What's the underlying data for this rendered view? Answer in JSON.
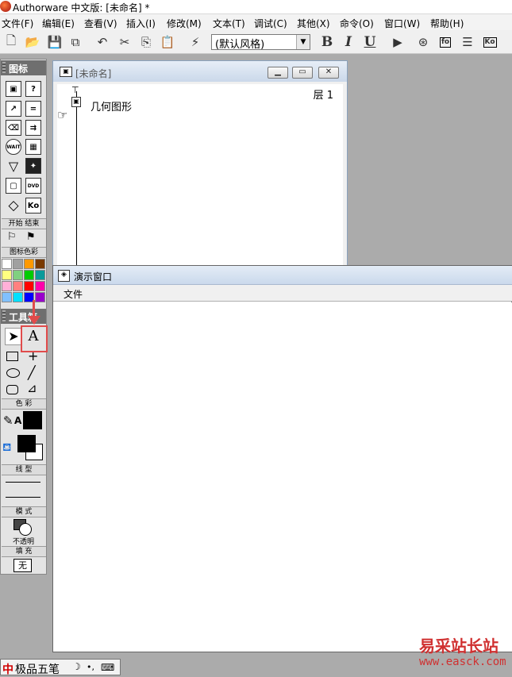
{
  "window": {
    "title": "Authorware 中文版: [未命名] *"
  },
  "menu": [
    "文件(F)",
    "编辑(E)",
    "查看(V)",
    "插入(I)",
    "修改(M)",
    "文本(T)",
    "调试(C)",
    "其他(X)",
    "命令(O)",
    "窗口(W)",
    "帮助(H)"
  ],
  "toolbar": {
    "style_value": "(默认风格)",
    "bold": "B",
    "italic": "I",
    "underline": "U",
    "btn_fo": "fo",
    "btn_ko": "Ko"
  },
  "palette": {
    "icons_header": "图标",
    "icon_wait_label": "WAIT",
    "icon_dvd_label": "DVD",
    "icon_ko_label": "Ko",
    "start_end_label": "开始 结束",
    "icon_color_label": "图标色彩",
    "icon_colors": [
      "#ffffff",
      "#a0a0a0",
      "#ff9900",
      "#7a3a00",
      "#ffff80",
      "#80d080",
      "#00cc00",
      "#0a9a9a",
      "#ffb0d8",
      "#ff8080",
      "#ff0000",
      "#ff00aa",
      "#80c0ff",
      "#00e0ff",
      "#0000ff",
      "#9900cc"
    ],
    "tools_header": "工具箱",
    "text_tool": "A",
    "color_label": "色 彩",
    "linetype_label": "线 型",
    "mode_label": "模 式",
    "mode_value": "不透明",
    "fill_label": "填 充",
    "fill_value": "无"
  },
  "flow_window": {
    "title": "[未命名]",
    "layer": "层 1",
    "icon_label": "几何图形"
  },
  "presentation_window": {
    "title": "演示窗口",
    "menu_file": "文件"
  },
  "ime": {
    "logo": "中",
    "name": "极品五笔"
  },
  "watermark": {
    "line1": "易采站长站",
    "line2": "www.easck.com"
  },
  "colors": {
    "highlight": "#e04b4b",
    "watermark": "#d03030"
  }
}
